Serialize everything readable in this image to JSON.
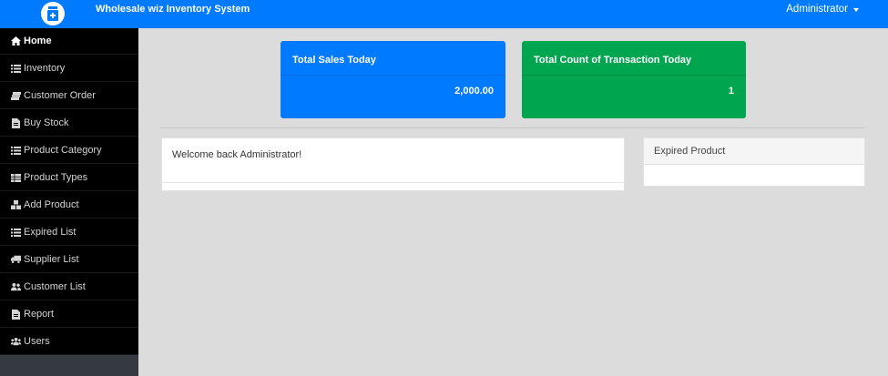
{
  "header": {
    "app_title": "Wholesale wiz Inventory System",
    "user_label": "Administrator",
    "brand_color": "#007bff",
    "logo_icon": "inventory-logo-icon"
  },
  "sidebar": {
    "items": [
      {
        "label": "Home",
        "icon": "home-icon",
        "active": true
      },
      {
        "label": "Inventory",
        "icon": "list-icon"
      },
      {
        "label": "Customer Order",
        "icon": "stack-icon"
      },
      {
        "label": "Buy Stock",
        "icon": "file-icon"
      },
      {
        "label": "Product Category",
        "icon": "list-icon"
      },
      {
        "label": "Product Types",
        "icon": "table-icon"
      },
      {
        "label": "Add Product",
        "icon": "boxes-icon"
      },
      {
        "label": "Expired List",
        "icon": "list-icon"
      },
      {
        "label": "Supplier List",
        "icon": "truck-icon"
      },
      {
        "label": "Customer List",
        "icon": "users-icon"
      },
      {
        "label": "Report",
        "icon": "file-icon"
      },
      {
        "label": "Users",
        "icon": "users-group-icon"
      }
    ]
  },
  "cards": {
    "sales": {
      "title": "Total Sales Today",
      "value": "2,000.00",
      "color": "#007bff"
    },
    "transactions": {
      "title": "Total Count of Transaction Today",
      "value": "1",
      "color": "#00a550"
    }
  },
  "welcome": {
    "text": "Welcome back Administrator!"
  },
  "expired": {
    "title": "Expired Product"
  }
}
